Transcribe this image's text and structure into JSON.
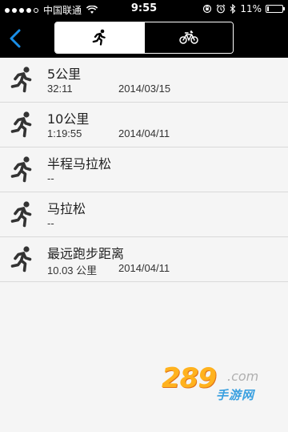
{
  "status_bar": {
    "carrier": "中国联通",
    "time": "9:55",
    "battery_percent": "11%",
    "battery_level": 0.11
  },
  "nav": {
    "back_icon": "chevron-left-icon",
    "segments": [
      {
        "icon": "running-icon",
        "selected": true
      },
      {
        "icon": "cycling-icon",
        "selected": false
      }
    ]
  },
  "records": [
    {
      "title": "5公里",
      "value": "32:11",
      "date": "2014/03/15"
    },
    {
      "title": "10公里",
      "value": "1:19:55",
      "date": "2014/04/11"
    },
    {
      "title": "半程马拉松",
      "value": "--",
      "date": ""
    },
    {
      "title": "马拉松",
      "value": "--",
      "date": ""
    },
    {
      "title": "最远跑步距离",
      "value": "10.03 公里",
      "date": "2014/04/11"
    }
  ],
  "watermark": {
    "main": "289",
    "suffix": ".com",
    "cn": "手游网"
  },
  "colors": {
    "nav_bg": "#000000",
    "accent": "#1a8fe8",
    "list_bg": "#f5f5f5"
  }
}
